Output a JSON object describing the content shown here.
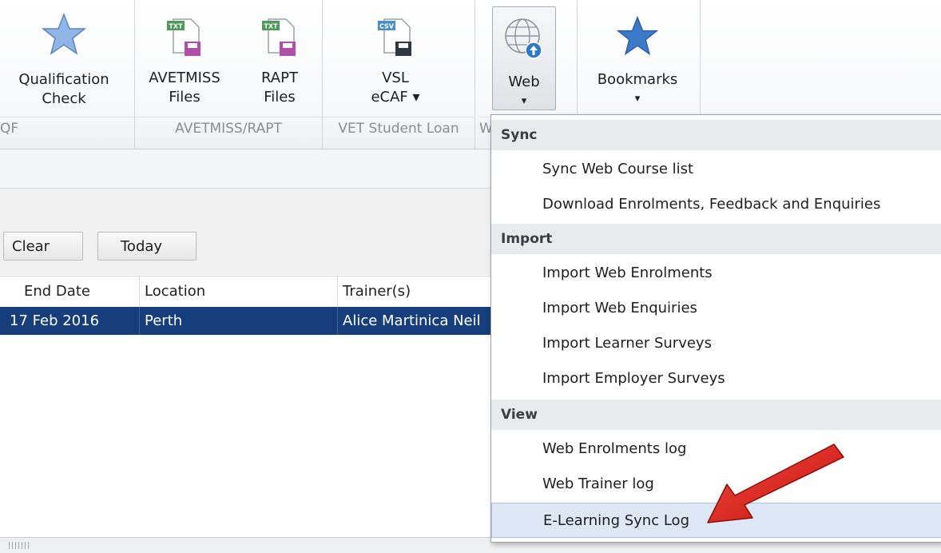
{
  "ribbon": {
    "groups": [
      {
        "label": "QF",
        "buttons": [
          {
            "label_line1": "Qualification",
            "label_line2": "Check",
            "icon": "star-icon"
          }
        ]
      },
      {
        "label": "AVETMISS/RAPT",
        "buttons": [
          {
            "label_line1": "AVETMISS",
            "label_line2": "Files",
            "icon": "txt-file-save-icon",
            "badge": "TXT"
          },
          {
            "label_line1": "RAPT",
            "label_line2": "Files",
            "icon": "txt-file-save-icon",
            "badge": "TXT"
          }
        ]
      },
      {
        "label": "VET Student Loan",
        "buttons": [
          {
            "label_line1": "VSL",
            "label_line2": "eCAF ▾",
            "icon": "csv-file-save-icon",
            "badge": "CSV"
          }
        ]
      },
      {
        "label": "W",
        "buttons": [
          {
            "label_line1": "Web",
            "label_line2": "▾",
            "icon": "globe-icon"
          }
        ]
      },
      {
        "label": "",
        "buttons": [
          {
            "label_line1": "Bookmarks",
            "label_line2": "▾",
            "icon": "star-icon"
          }
        ]
      }
    ]
  },
  "filters": {
    "clear_label": "Clear",
    "today_label": "Today"
  },
  "grid": {
    "columns": [
      "End Date",
      "Location",
      "Trainer(s)"
    ],
    "rows": [
      {
        "end_date": "17 Feb 2016",
        "location": "Perth",
        "trainers": "Alice Martinica  Neil"
      }
    ]
  },
  "web_menu": {
    "sections": [
      {
        "header": "Sync",
        "items": [
          "Sync Web Course list",
          "Download Enrolments, Feedback and Enquiries"
        ]
      },
      {
        "header": "Import",
        "items": [
          "Import Web Enrolments",
          "Import Web Enquiries",
          "Import Learner Surveys",
          "Import Employer Surveys"
        ]
      },
      {
        "header": "View",
        "items": [
          "Web Enrolments log",
          "Web Trainer log",
          "E-Learning Sync Log"
        ]
      }
    ],
    "highlighted_item": "E-Learning Sync Log"
  },
  "colors": {
    "selected_row": "#163d7c",
    "highlight": "#dde7f5",
    "arrow": "#e3231b",
    "star": "#6f9fd8"
  }
}
